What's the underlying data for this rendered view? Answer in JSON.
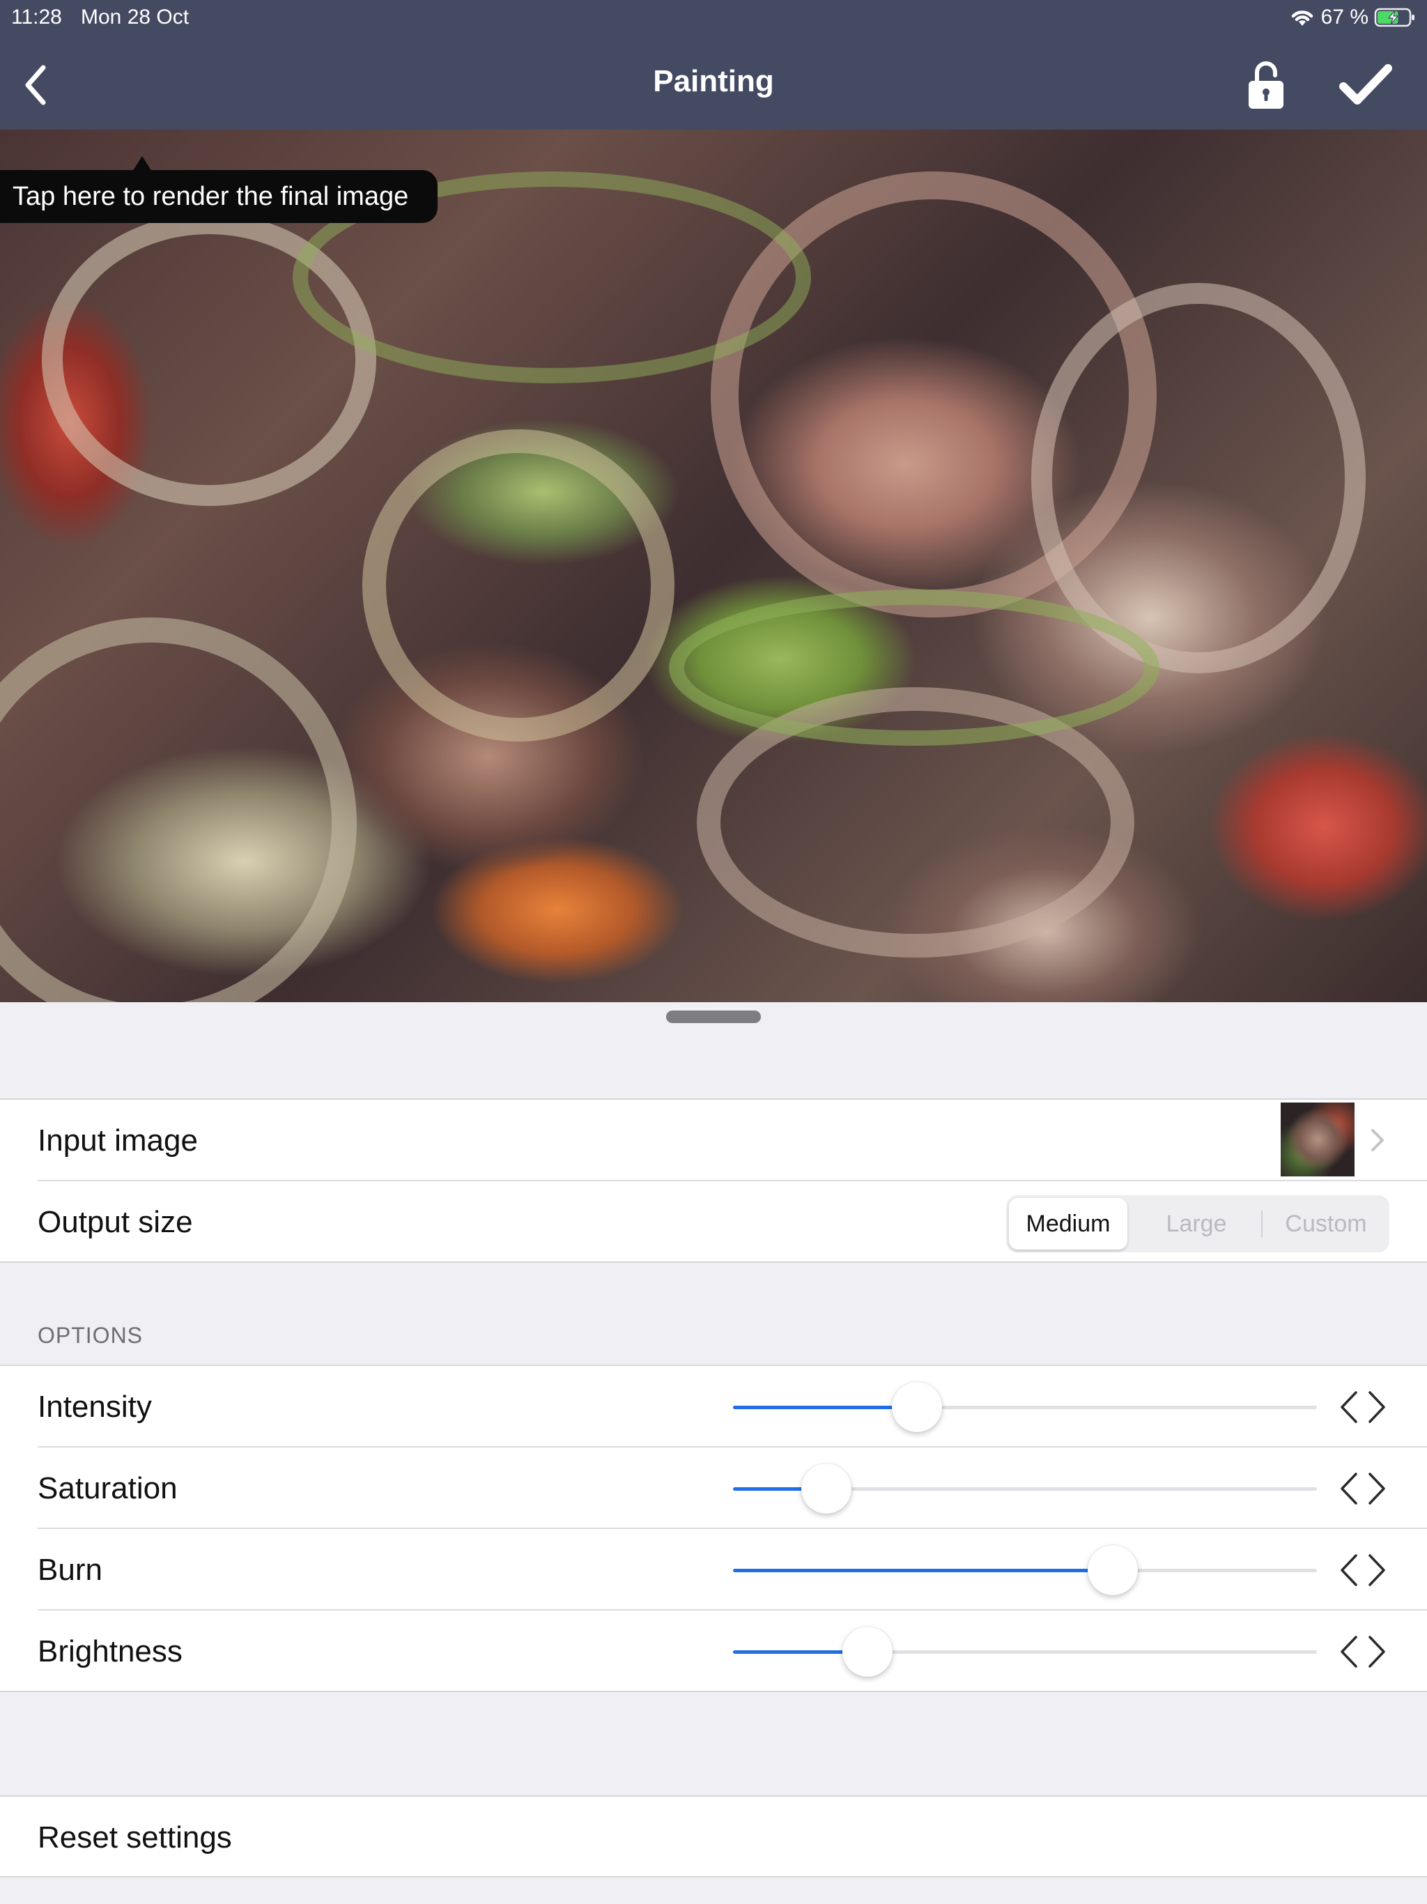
{
  "status_bar": {
    "time": "11:28",
    "date": "Mon 28 Oct",
    "battery_text": "67 %",
    "wifi_icon": "wifi-icon",
    "battery_icon": "battery-charging-icon",
    "battery_level": 0.67
  },
  "nav": {
    "title": "Painting",
    "back_icon": "chevron-left-icon",
    "lock_icon": "unlock-icon",
    "confirm_icon": "checkmark-icon"
  },
  "preview": {
    "tooltip": "Tap here to render the final image"
  },
  "settings": {
    "input_image_label": "Input image",
    "output_size_label": "Output size",
    "output_size_options": [
      "Medium",
      "Large",
      "Custom"
    ],
    "output_size_selected": "Medium"
  },
  "options": {
    "header": "OPTIONS",
    "sliders": [
      {
        "label": "Intensity",
        "value": 0.315
      },
      {
        "label": "Saturation",
        "value": 0.16
      },
      {
        "label": "Burn",
        "value": 0.65
      },
      {
        "label": "Brightness",
        "value": 0.23
      }
    ]
  },
  "footer": {
    "reset_label": "Reset settings"
  },
  "colors": {
    "header_bg": "#444a62",
    "accent": "#1e6fe6",
    "grouped_bg": "#f0eff4",
    "battery_green": "#4cd964"
  }
}
